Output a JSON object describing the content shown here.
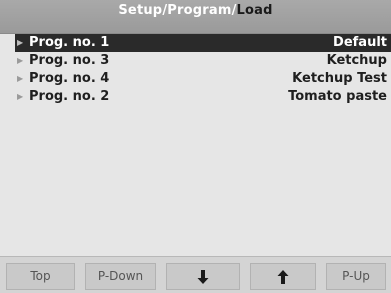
{
  "breadcrumb": {
    "parts": [
      "Setup",
      "Program",
      "Load"
    ],
    "separator": "/"
  },
  "programs": [
    {
      "prog": "Prog. no. 1",
      "name": "Default",
      "selected": true
    },
    {
      "prog": "Prog. no. 3",
      "name": "Ketchup",
      "selected": false
    },
    {
      "prog": "Prog. no. 4",
      "name": "Ketchup Test",
      "selected": false
    },
    {
      "prog": "Prog. no. 2",
      "name": "Tomato paste",
      "selected": false
    }
  ],
  "softkeys": {
    "top": "Top",
    "page_down": "P-Down",
    "down_icon": "arrow-down-icon",
    "up_icon": "arrow-up-icon",
    "page_up": "P-Up"
  },
  "colors": {
    "selection": "#2a2a2a",
    "title_bar": "#a0a0a0",
    "background": "#e6e6e6"
  }
}
